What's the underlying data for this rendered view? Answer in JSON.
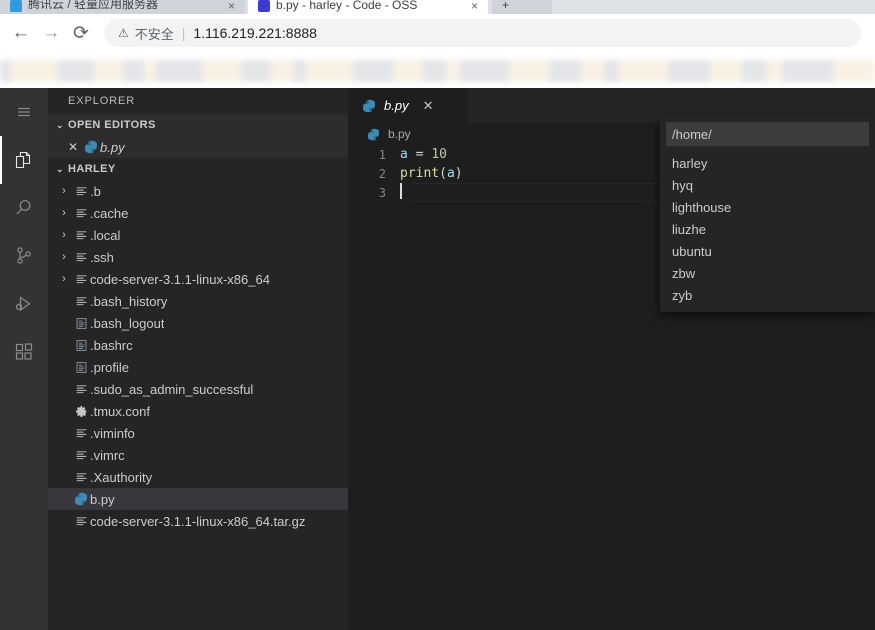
{
  "browser": {
    "tabs": [
      {
        "title": "腾讯云 / 轻量应用服务器",
        "state": "inactive",
        "close_label": "×",
        "favicon": "cloud-favicon"
      },
      {
        "title": "b.py - harley - Code - OSS",
        "state": "active",
        "close_label": "×",
        "favicon": "vscode-favicon"
      }
    ],
    "newtab_label": "+",
    "nav": {
      "back_label": "←",
      "forward_label": "→",
      "reload_label": "⟳"
    },
    "omnibox": {
      "warn_icon": "⚠",
      "security_label": "不安全",
      "separator": "|",
      "url": "1.116.219.221:8888"
    }
  },
  "activity_bar": {
    "items": [
      {
        "name": "menu",
        "label": "Menu",
        "active": false
      },
      {
        "name": "explorer",
        "label": "Explorer",
        "active": true
      },
      {
        "name": "search",
        "label": "Search",
        "active": false
      },
      {
        "name": "source-control",
        "label": "Source Control",
        "active": false
      },
      {
        "name": "run-debug",
        "label": "Run and Debug",
        "active": false
      },
      {
        "name": "extensions",
        "label": "Extensions",
        "active": false
      }
    ]
  },
  "sidebar": {
    "title": "EXPLORER",
    "open_editors": {
      "header": "OPEN EDITORS",
      "twisty": "⌄",
      "items": [
        {
          "close": "✕",
          "icon": "python-icon",
          "label": "b.py"
        }
      ]
    },
    "folder": {
      "header": "HARLEY",
      "twisty": "⌄",
      "items": [
        {
          "kind": "folder",
          "twisty": "›",
          "icon": "folder-icon",
          "label": ".b",
          "selected": false
        },
        {
          "kind": "folder",
          "twisty": "›",
          "icon": "folder-icon",
          "label": ".cache",
          "selected": false
        },
        {
          "kind": "folder",
          "twisty": "›",
          "icon": "folder-icon",
          "label": ".local",
          "selected": false
        },
        {
          "kind": "folder",
          "twisty": "›",
          "icon": "folder-icon",
          "label": ".ssh",
          "selected": false
        },
        {
          "kind": "folder",
          "twisty": "›",
          "icon": "folder-icon",
          "label": "code-server-3.1.1-linux-x86_64",
          "selected": false
        },
        {
          "kind": "file",
          "twisty": "",
          "icon": "text-file-icon",
          "label": ".bash_history",
          "selected": false
        },
        {
          "kind": "file",
          "twisty": "",
          "icon": "doc-file-icon",
          "label": ".bash_logout",
          "selected": false
        },
        {
          "kind": "file",
          "twisty": "",
          "icon": "doc-file-icon",
          "label": ".bashrc",
          "selected": false
        },
        {
          "kind": "file",
          "twisty": "",
          "icon": "doc-file-icon",
          "label": ".profile",
          "selected": false
        },
        {
          "kind": "file",
          "twisty": "",
          "icon": "text-file-icon",
          "label": ".sudo_as_admin_successful",
          "selected": false
        },
        {
          "kind": "file",
          "twisty": "",
          "icon": "gear-file-icon",
          "label": ".tmux.conf",
          "selected": false
        },
        {
          "kind": "file",
          "twisty": "",
          "icon": "text-file-icon",
          "label": ".viminfo",
          "selected": false
        },
        {
          "kind": "file",
          "twisty": "",
          "icon": "text-file-icon",
          "label": ".vimrc",
          "selected": false
        },
        {
          "kind": "file",
          "twisty": "",
          "icon": "text-file-icon",
          "label": ".Xauthority",
          "selected": false
        },
        {
          "kind": "file",
          "twisty": "",
          "icon": "python-icon",
          "label": "b.py",
          "selected": true
        },
        {
          "kind": "file",
          "twisty": "",
          "icon": "text-file-icon",
          "label": "code-server-3.1.1-linux-x86_64.tar.gz",
          "selected": false
        }
      ]
    }
  },
  "editor": {
    "tab": {
      "icon": "python-icon",
      "label": "b.py",
      "close": "✕"
    },
    "breadcrumb": {
      "icon": "python-icon",
      "label": "b.py"
    },
    "lines": [
      {
        "number": "1",
        "tokens": [
          {
            "text": "a",
            "cls": "tok-var"
          },
          {
            "text": " = ",
            "cls": "tok-op"
          },
          {
            "text": "10",
            "cls": "tok-num"
          }
        ]
      },
      {
        "number": "2",
        "tokens": [
          {
            "text": "print",
            "cls": "tok-fn"
          },
          {
            "text": "(",
            "cls": "tok-paren"
          },
          {
            "text": "a",
            "cls": "tok-var"
          },
          {
            "text": ")",
            "cls": "tok-paren"
          }
        ]
      },
      {
        "number": "3",
        "tokens": []
      }
    ]
  },
  "picker": {
    "input_value": "/home/",
    "input_placeholder": "/home/",
    "items": [
      {
        "label": "harley",
        "selected": false
      },
      {
        "label": "hyq",
        "selected": false
      },
      {
        "label": "lighthouse",
        "selected": false
      },
      {
        "label": "liuzhe",
        "selected": false
      },
      {
        "label": "ubuntu",
        "selected": false
      },
      {
        "label": "zbw",
        "selected": false
      },
      {
        "label": "zyb",
        "selected": false
      }
    ]
  },
  "colors": {
    "activity_bar": "#333333",
    "sidebar": "#252526",
    "editor": "#1e1e1e",
    "selection": "#37373d",
    "accent_blue": "#3794ff",
    "python_icon": "#3c8ab8",
    "browser_chrome": "#dee1e6"
  }
}
